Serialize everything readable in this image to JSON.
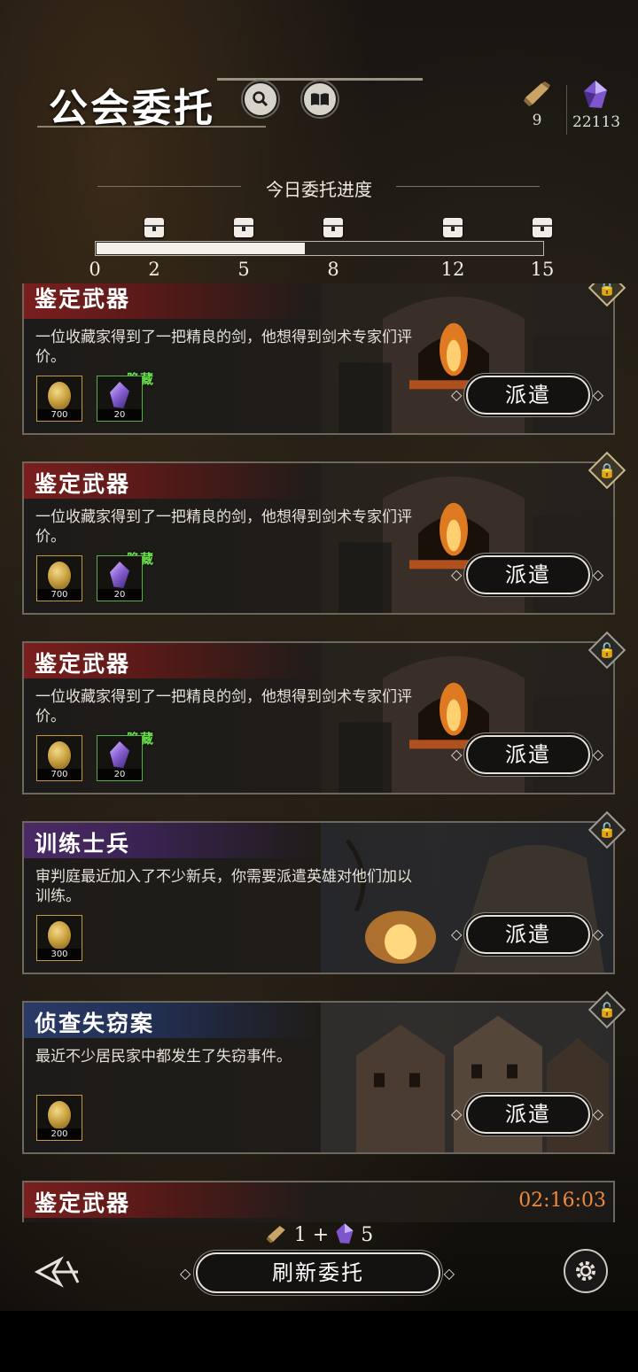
{
  "header": {
    "title": "公会委托",
    "scroll_count": "9",
    "crystal_count": "22113"
  },
  "progress": {
    "label": "今日委托进度",
    "current": 7,
    "max": 15,
    "milestones": [
      "0",
      "2",
      "5",
      "8",
      "12",
      "15"
    ]
  },
  "quests": [
    {
      "name": "鉴定武器",
      "color": "red",
      "desc": "一位收藏家得到了一把精良的剑，他想得到剑术专家们评价。",
      "rewards": [
        {
          "type": "coin",
          "qty": "700"
        },
        {
          "type": "gem",
          "qty": "20",
          "tag": "隐藏"
        }
      ],
      "action": "派遣",
      "locked": true
    },
    {
      "name": "鉴定武器",
      "color": "red",
      "desc": "一位收藏家得到了一把精良的剑，他想得到剑术专家们评价。",
      "rewards": [
        {
          "type": "coin",
          "qty": "700"
        },
        {
          "type": "gem",
          "qty": "20",
          "tag": "隐藏"
        }
      ],
      "action": "派遣",
      "locked": true
    },
    {
      "name": "鉴定武器",
      "color": "red",
      "desc": "一位收藏家得到了一把精良的剑，他想得到剑术专家们评价。",
      "rewards": [
        {
          "type": "coin",
          "qty": "700"
        },
        {
          "type": "gem",
          "qty": "20",
          "tag": "隐藏"
        }
      ],
      "action": "派遣",
      "locked": false
    },
    {
      "name": "训练士兵",
      "color": "purple",
      "desc": "审判庭最近加入了不少新兵，你需要派遣英雄对他们加以训练。",
      "rewards": [
        {
          "type": "coin",
          "qty": "300"
        }
      ],
      "action": "派遣",
      "locked": false
    },
    {
      "name": "侦查失窃案",
      "color": "blue",
      "desc": "最近不少居民家中都发生了失窃事件。",
      "rewards": [
        {
          "type": "coin",
          "qty": "200"
        }
      ],
      "action": "派遣",
      "locked": false
    },
    {
      "name": "鉴定武器",
      "color": "red",
      "timer": "02:16:03"
    }
  ],
  "footer": {
    "cost_scroll": "1",
    "cost_plus": "+",
    "cost_crystal": "5",
    "refresh_label": "刷新委托"
  },
  "colors": {
    "accent_timer": "#f08a3a",
    "hidden_tag": "#68e04a",
    "coin_border": "#c59a3d"
  }
}
